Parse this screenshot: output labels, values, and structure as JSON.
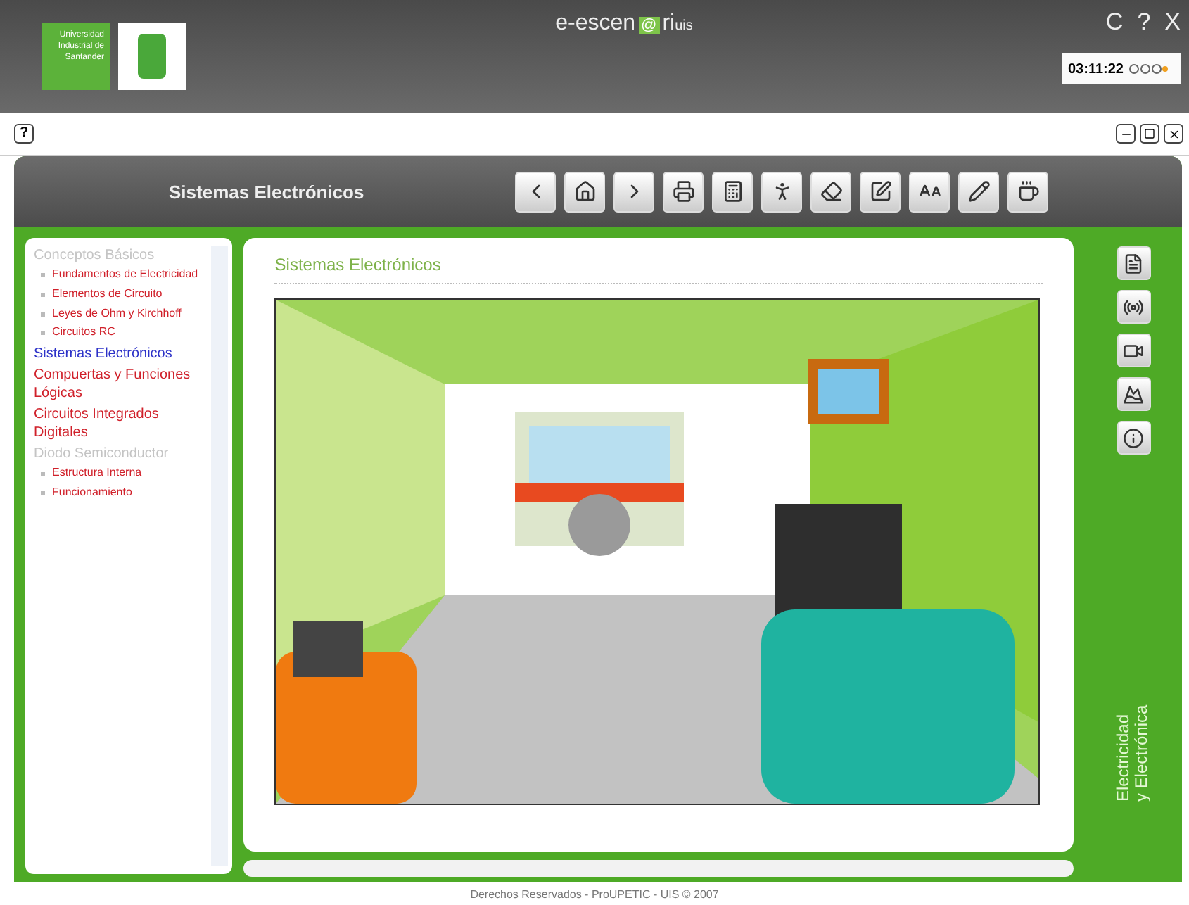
{
  "header": {
    "university": "Universidad Industrial de Santander",
    "brand": {
      "prefix": "e-escen",
      "at": "@",
      "suffix": "ri",
      "sub": "uis"
    },
    "controls": [
      "C",
      "?",
      "X"
    ],
    "clock": "03:11:22"
  },
  "window_bar": {
    "help": "?"
  },
  "toolbar": {
    "title": "Sistemas Electrónicos"
  },
  "nav": [
    {
      "label": "Conceptos Básicos",
      "selected": false,
      "disabled": true,
      "children": [
        {
          "label": "Fundamentos de Electricidad"
        },
        {
          "label": "Elementos de Circuito"
        },
        {
          "label": "Leyes de Ohm y Kirchhoff"
        },
        {
          "label": "Circuitos RC"
        }
      ]
    },
    {
      "label": "Sistemas Electrónicos",
      "selected": true,
      "disabled": false
    },
    {
      "label": "Compuertas y Funciones Lógicas",
      "selected": false,
      "disabled": false
    },
    {
      "label": "Circuitos Integrados Digitales",
      "selected": false,
      "disabled": false
    },
    {
      "label": "Diodo Semiconductor",
      "selected": false,
      "disabled": true,
      "children": [
        {
          "label": "Estructura Interna"
        },
        {
          "label": "Funcionamiento"
        }
      ]
    }
  ],
  "content": {
    "heading": "Sistemas Electrónicos"
  },
  "course": {
    "line1": "Electricidad",
    "line2": "y Electrónica"
  },
  "footer": "Derechos Reservados - ProUPETIC - UIS © 2007"
}
